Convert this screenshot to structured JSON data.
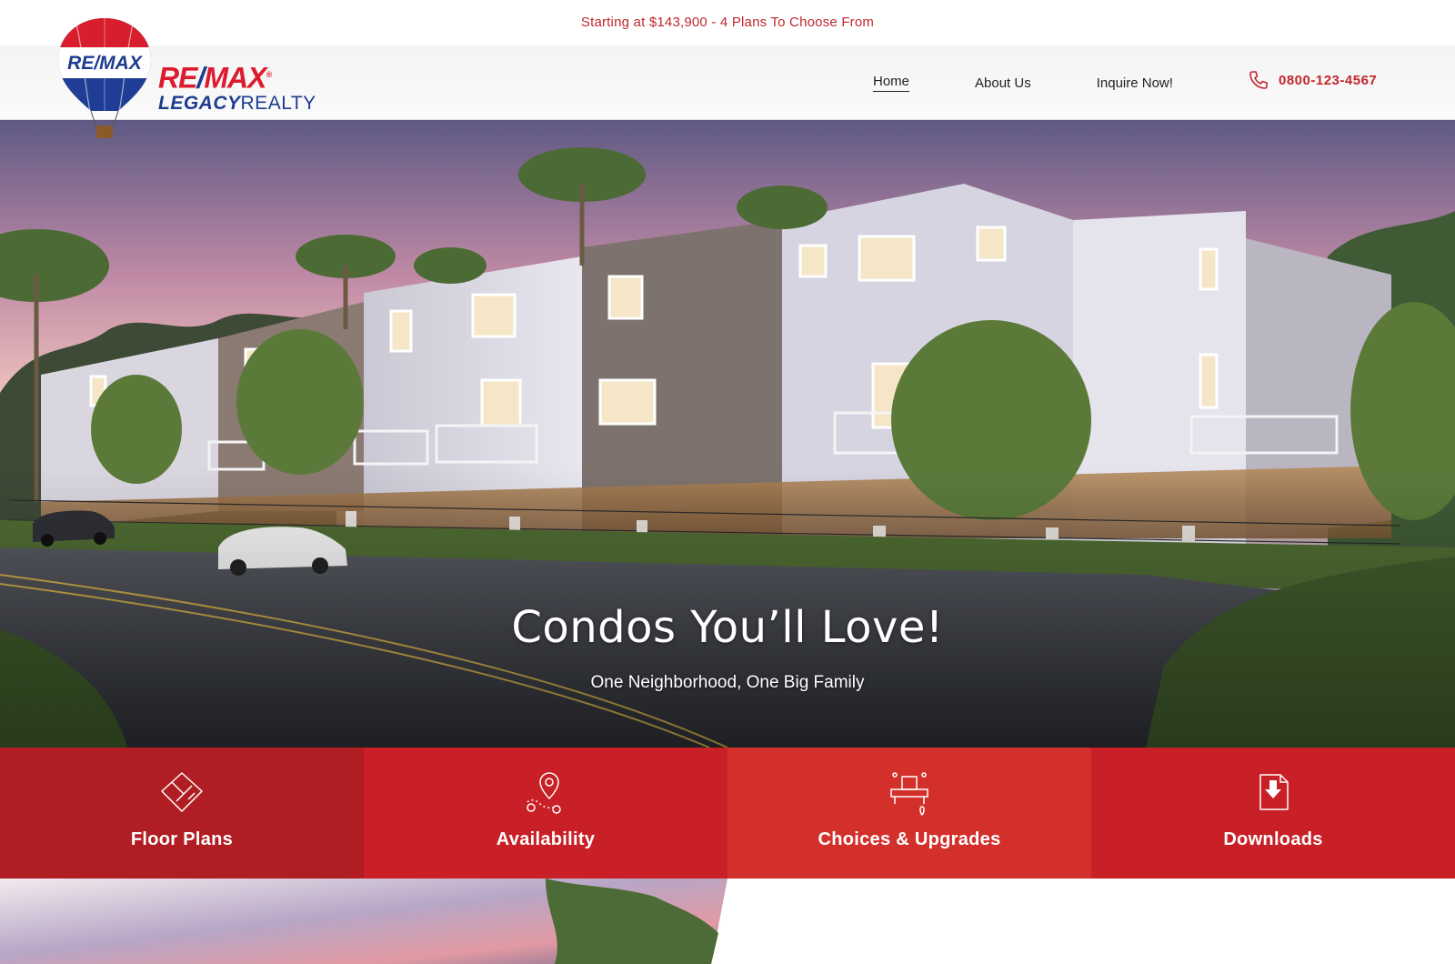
{
  "topbar": {
    "announcement": "Starting at $143,900 - 4 Plans To Choose From"
  },
  "brand": {
    "top_left": "RE",
    "slash": "/",
    "top_right": "MAX",
    "registered": "®",
    "bottom_bold": "LEGACY",
    "bottom_light": "REALTY",
    "balloon_text": "RE/MAX"
  },
  "nav": {
    "items": [
      {
        "label": "Home"
      },
      {
        "label": "About Us"
      },
      {
        "label": "Inquire Now!"
      }
    ],
    "phone": "0800-123-4567",
    "phone_icon": "phone-icon"
  },
  "hero": {
    "title": "Condos You’ll Love!",
    "subtitle": "One Neighborhood, One Big Family"
  },
  "tiles": [
    {
      "label": "Floor Plans",
      "icon": "floor-plan-icon",
      "color": "#b01e23"
    },
    {
      "label": "Availability",
      "icon": "map-pin-icon",
      "color": "#c82026"
    },
    {
      "label": "Choices & Upgrades",
      "icon": "kitchen-icon",
      "color": "#d4302b"
    },
    {
      "label": "Downloads",
      "icon": "download-file-icon",
      "color": "#c82026"
    }
  ],
  "colors": {
    "accent": "#c0272d",
    "brand_blue": "#1d3c8f"
  }
}
